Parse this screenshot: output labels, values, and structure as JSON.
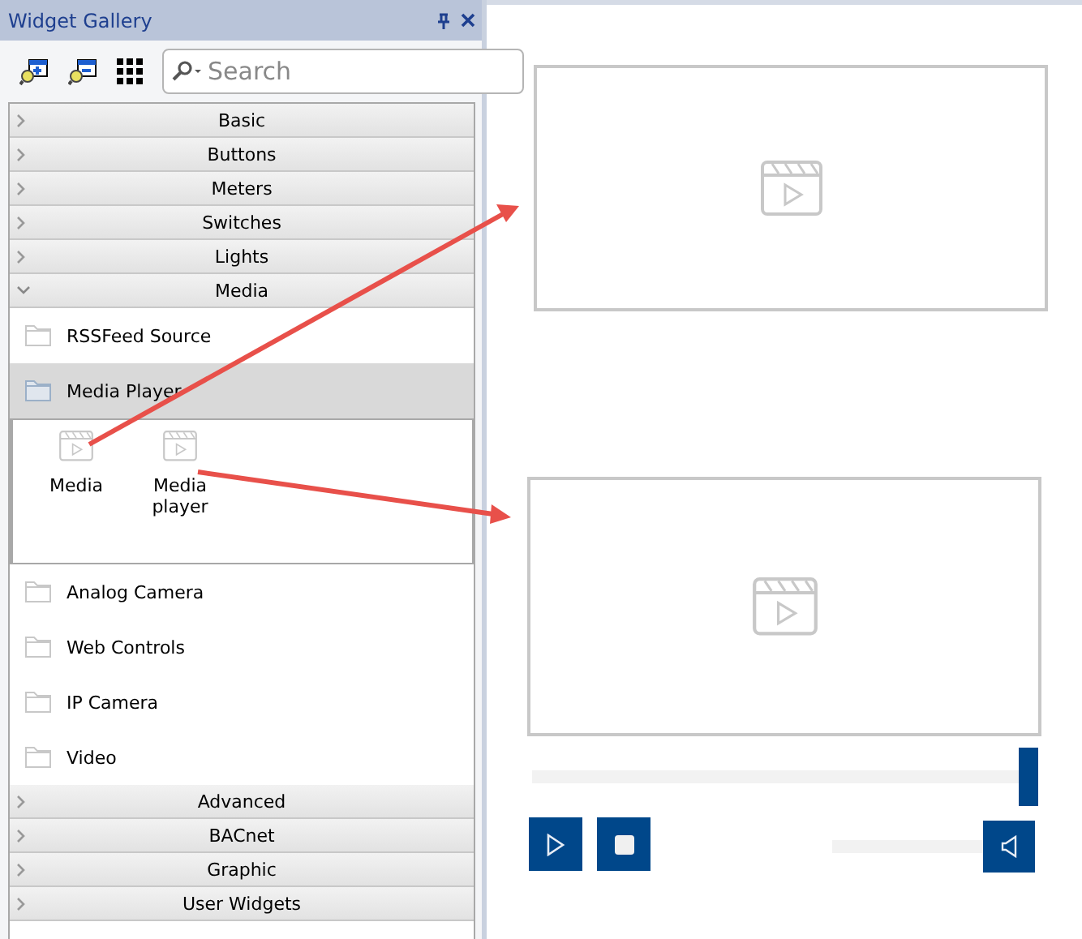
{
  "panel": {
    "title": "Widget Gallery",
    "search": {
      "placeholder": "Search"
    },
    "categories": [
      {
        "label": "Basic",
        "expanded": false
      },
      {
        "label": "Buttons",
        "expanded": false
      },
      {
        "label": "Meters",
        "expanded": false
      },
      {
        "label": "Switches",
        "expanded": false
      },
      {
        "label": "Lights",
        "expanded": false
      },
      {
        "label": "Media",
        "expanded": true,
        "children": [
          {
            "label": "RSSFeed Source",
            "selected": false
          },
          {
            "label": "Media Player",
            "selected": true,
            "widgets": [
              {
                "label": "Media"
              },
              {
                "label": "Media player"
              }
            ]
          },
          {
            "label": "Analog Camera",
            "selected": false
          },
          {
            "label": "Web Controls",
            "selected": false
          },
          {
            "label": "IP Camera",
            "selected": false
          },
          {
            "label": "Video",
            "selected": false
          }
        ]
      },
      {
        "label": "Advanced",
        "expanded": false
      },
      {
        "label": "BACnet",
        "expanded": false
      },
      {
        "label": "Graphic",
        "expanded": false
      },
      {
        "label": "User Widgets",
        "expanded": false
      }
    ]
  },
  "canvas": {
    "media_widgets": [
      {
        "kind": "frame"
      },
      {
        "kind": "player",
        "progress": {
          "level": 1.0
        },
        "volume": {
          "level": 1.0
        }
      }
    ]
  }
}
